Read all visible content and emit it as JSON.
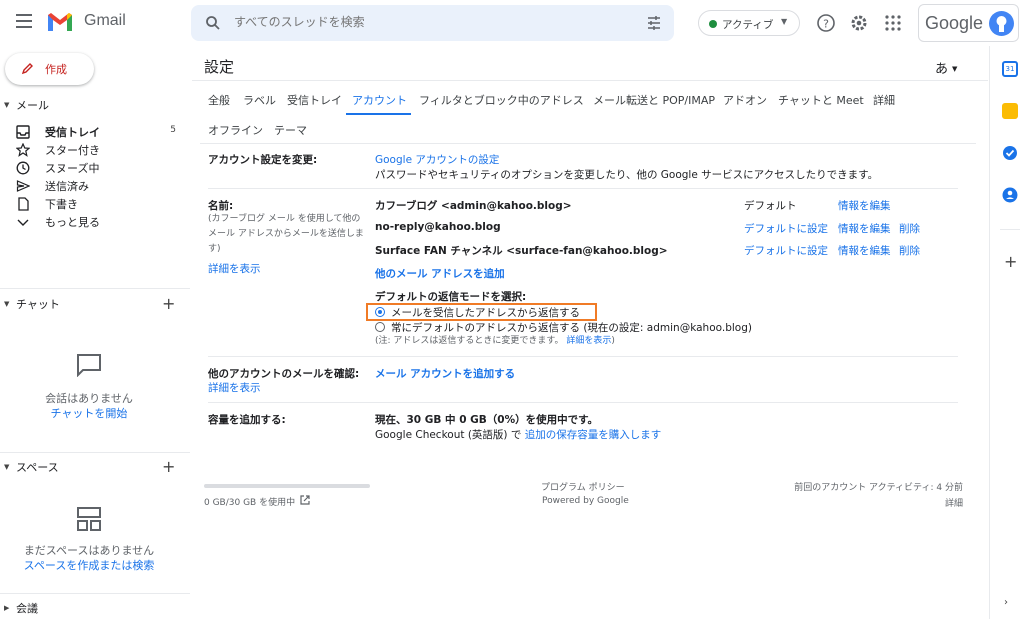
{
  "header": {
    "brand": "Gmail",
    "search_placeholder": "すべてのスレッドを検索",
    "status_label": "アクティブ",
    "google_text": "Google"
  },
  "sidebar": {
    "compose": "作成",
    "mail_header": "メール",
    "items": [
      {
        "label": "受信トレイ",
        "count": "5",
        "icon": "inbox-icon"
      },
      {
        "label": "スター付き",
        "count": "",
        "icon": "star-icon"
      },
      {
        "label": "スヌーズ中",
        "count": "",
        "icon": "clock-icon"
      },
      {
        "label": "送信済み",
        "count": "",
        "icon": "send-icon"
      },
      {
        "label": "下書き",
        "count": "",
        "icon": "draft-icon"
      },
      {
        "label": "もっと見る",
        "count": "",
        "icon": "chevron-down-icon"
      }
    ],
    "chat_header": "チャット",
    "chat_empty": "会話はありません",
    "chat_start": "チャットを開始",
    "spaces_header": "スペース",
    "spaces_empty": "まだスペースはありません",
    "spaces_create": "スペースを作成または検索",
    "meet_header": "会議"
  },
  "settings": {
    "title": "設定",
    "lang_btn": "あ",
    "tabs_row1": [
      "全般",
      "ラベル",
      "受信トレイ",
      "アカウント",
      "フィルタとブロック中のアドレス",
      "メール転送と POP/IMAP",
      "アドオン",
      "チャットと Meet",
      "詳細"
    ],
    "tabs_row2": [
      "オフライン",
      "テーマ"
    ],
    "account_change_label": "アカウント設定を変更:",
    "account_link": "Google アカウントの設定",
    "account_desc": "パスワードやセキュリティのオプションを変更したり、他の Google サービスにアクセスしたりできます。",
    "name_label": "名前:",
    "name_note_1": "(カフーブログ メール を使用して他の",
    "name_note_2": "メール アドレスからメールを送信しま",
    "name_note_3": "す)",
    "name_details": "詳細を表示",
    "accounts": [
      {
        "name": "カフーブログ <admin@kahoo.blog>",
        "default": "デフォルト",
        "edit": "情報を編集",
        "delete": ""
      },
      {
        "name": "no-reply@kahoo.blog",
        "default": "デフォルトに設定",
        "edit": "情報を編集",
        "delete": "削除"
      },
      {
        "name": "Surface FAN チャンネル <surface-fan@kahoo.blog>",
        "default": "デフォルトに設定",
        "edit": "情報を編集",
        "delete": "削除"
      }
    ],
    "add_address": "他のメール アドレスを追加",
    "reply_mode_label": "デフォルトの返信モードを選択:",
    "reply_option_1": "メールを受信したアドレスから返信する",
    "reply_option_2": "常にデフォルトのアドレスから返信する (現在の設定: admin@kahoo.blog)",
    "reply_note": "(注: アドレスは返信するときに変更できます。",
    "reply_note_link": "詳細を表示",
    "reply_note_end": ")",
    "other_accounts_label": "他のアカウントのメールを確認:",
    "other_accounts_details": "詳細を表示",
    "add_mail_account": "メール アカウントを追加する",
    "storage_label": "容量を追加する:",
    "storage_usage": "現在、30 GB 中 0 GB（0%）を使用中です。",
    "storage_checkout": "Google Checkout (英語版) で",
    "storage_buy": "追加の保存容量を購入します"
  },
  "footer": {
    "usage": "0 GB/30 GB を使用中",
    "policy": "プログラム ポリシー",
    "powered": "Powered by Google",
    "last_activity": "前回のアカウント アクティビティ: 4 分前",
    "details": "詳細"
  },
  "colors": {
    "accent": "#1a73e8",
    "highlight": "#f07b26",
    "compose_text": "#c5221f"
  }
}
